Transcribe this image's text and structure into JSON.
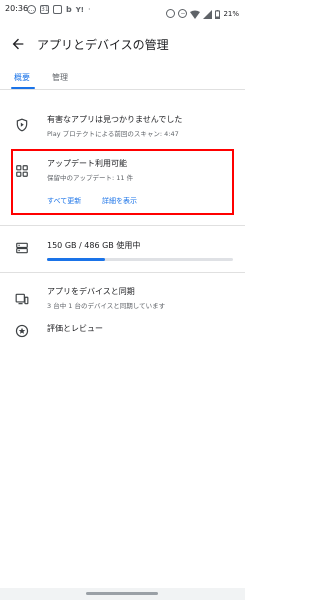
{
  "status_bar": {
    "time": "20:36",
    "battery_text": "21%"
  },
  "app_bar": {
    "title": "アプリとデバイスの管理"
  },
  "tabs": [
    {
      "label": "概要"
    },
    {
      "label": "管理"
    }
  ],
  "protect": {
    "title": "有害なアプリは見つかりませんでした",
    "subtitle": "Play プロテクトによる前回のスキャン: 4:47"
  },
  "updates": {
    "title": "アップデート利用可能",
    "subtitle": "保留中のアップデート: 11 件",
    "update_all_label": "すべて更新",
    "details_label": "詳細を表示"
  },
  "storage": {
    "text": "150 GB / 486 GB 使用中",
    "used_fraction": 0.31
  },
  "sync": {
    "title": "アプリをデバイスと同期",
    "subtitle": "3 台中 1 台のデバイスと同期しています"
  },
  "ratings": {
    "title": "評価とレビュー"
  },
  "colors": {
    "accent": "#1a73e8",
    "highlight": "#ff0000"
  }
}
